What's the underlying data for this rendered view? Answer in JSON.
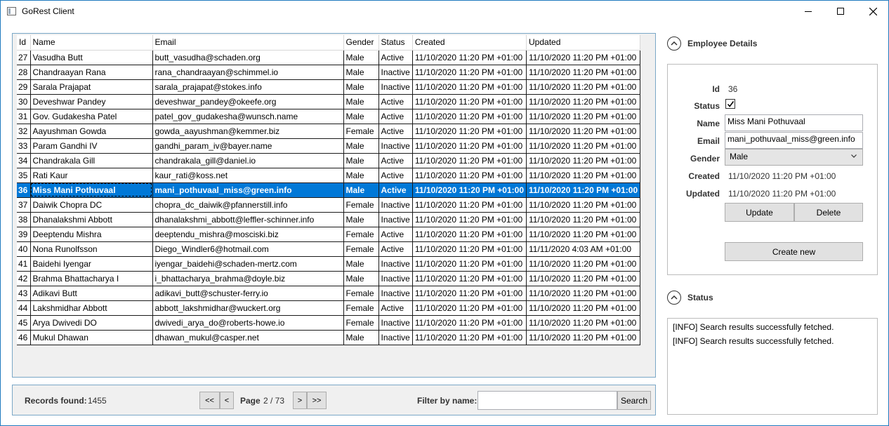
{
  "window": {
    "title": "GoRest Client"
  },
  "table": {
    "columns": [
      "Id",
      "Name",
      "Email",
      "Gender",
      "Status",
      "Created",
      "Updated"
    ],
    "selected_id": "36",
    "rows": [
      {
        "id": "27",
        "name": "Vasudha Butt",
        "email": "butt_vasudha@schaden.org",
        "gender": "Male",
        "status": "Active",
        "created": "11/10/2020 11:20 PM +01:00",
        "updated": "11/10/2020 11:20 PM +01:00"
      },
      {
        "id": "28",
        "name": "Chandraayan Rana",
        "email": "rana_chandraayan@schimmel.io",
        "gender": "Male",
        "status": "Inactive",
        "created": "11/10/2020 11:20 PM +01:00",
        "updated": "11/10/2020 11:20 PM +01:00"
      },
      {
        "id": "29",
        "name": "Sarala Prajapat",
        "email": "sarala_prajapat@stokes.info",
        "gender": "Male",
        "status": "Inactive",
        "created": "11/10/2020 11:20 PM +01:00",
        "updated": "11/10/2020 11:20 PM +01:00"
      },
      {
        "id": "30",
        "name": "Deveshwar Pandey",
        "email": "deveshwar_pandey@okeefe.org",
        "gender": "Male",
        "status": "Active",
        "created": "11/10/2020 11:20 PM +01:00",
        "updated": "11/10/2020 11:20 PM +01:00"
      },
      {
        "id": "31",
        "name": "Gov. Gudakesha Patel",
        "email": "patel_gov_gudakesha@wunsch.name",
        "gender": "Male",
        "status": "Active",
        "created": "11/10/2020 11:20 PM +01:00",
        "updated": "11/10/2020 11:20 PM +01:00"
      },
      {
        "id": "32",
        "name": "Aayushman Gowda",
        "email": "gowda_aayushman@kemmer.biz",
        "gender": "Female",
        "status": "Active",
        "created": "11/10/2020 11:20 PM +01:00",
        "updated": "11/10/2020 11:20 PM +01:00"
      },
      {
        "id": "33",
        "name": "Param Gandhi IV",
        "email": "gandhi_param_iv@bayer.name",
        "gender": "Male",
        "status": "Inactive",
        "created": "11/10/2020 11:20 PM +01:00",
        "updated": "11/10/2020 11:20 PM +01:00"
      },
      {
        "id": "34",
        "name": "Chandrakala Gill",
        "email": "chandrakala_gill@daniel.io",
        "gender": "Male",
        "status": "Active",
        "created": "11/10/2020 11:20 PM +01:00",
        "updated": "11/10/2020 11:20 PM +01:00"
      },
      {
        "id": "35",
        "name": "Rati Kaur",
        "email": "kaur_rati@koss.net",
        "gender": "Male",
        "status": "Active",
        "created": "11/10/2020 11:20 PM +01:00",
        "updated": "11/10/2020 11:20 PM +01:00"
      },
      {
        "id": "36",
        "name": "Miss Mani Pothuvaal",
        "email": "mani_pothuvaal_miss@green.info",
        "gender": "Male",
        "status": "Active",
        "created": "11/10/2020 11:20 PM +01:00",
        "updated": "11/10/2020 11:20 PM +01:00"
      },
      {
        "id": "37",
        "name": "Daiwik Chopra DC",
        "email": "chopra_dc_daiwik@pfannerstill.info",
        "gender": "Female",
        "status": "Inactive",
        "created": "11/10/2020 11:20 PM +01:00",
        "updated": "11/10/2020 11:20 PM +01:00"
      },
      {
        "id": "38",
        "name": "Dhanalakshmi Abbott",
        "email": "dhanalakshmi_abbott@leffler-schinner.info",
        "gender": "Male",
        "status": "Inactive",
        "created": "11/10/2020 11:20 PM +01:00",
        "updated": "11/10/2020 11:20 PM +01:00"
      },
      {
        "id": "39",
        "name": "Deeptendu Mishra",
        "email": "deeptendu_mishra@mosciski.biz",
        "gender": "Female",
        "status": "Active",
        "created": "11/10/2020 11:20 PM +01:00",
        "updated": "11/10/2020 11:20 PM +01:00"
      },
      {
        "id": "40",
        "name": "Nona Runolfsson",
        "email": "Diego_Windler6@hotmail.com",
        "gender": "Female",
        "status": "Active",
        "created": "11/10/2020 11:20 PM +01:00",
        "updated": "11/11/2020 4:03 AM +01:00"
      },
      {
        "id": "41",
        "name": "Baidehi Iyengar",
        "email": "iyengar_baidehi@schaden-mertz.com",
        "gender": "Male",
        "status": "Inactive",
        "created": "11/10/2020 11:20 PM +01:00",
        "updated": "11/10/2020 11:20 PM +01:00"
      },
      {
        "id": "42",
        "name": "Brahma Bhattacharya I",
        "email": "i_bhattacharya_brahma@doyle.biz",
        "gender": "Male",
        "status": "Inactive",
        "created": "11/10/2020 11:20 PM +01:00",
        "updated": "11/10/2020 11:20 PM +01:00"
      },
      {
        "id": "43",
        "name": "Adikavi Butt",
        "email": "adikavi_butt@schuster-ferry.io",
        "gender": "Female",
        "status": "Inactive",
        "created": "11/10/2020 11:20 PM +01:00",
        "updated": "11/10/2020 11:20 PM +01:00"
      },
      {
        "id": "44",
        "name": "Lakshmidhar Abbott",
        "email": "abbott_lakshmidhar@wuckert.org",
        "gender": "Female",
        "status": "Active",
        "created": "11/10/2020 11:20 PM +01:00",
        "updated": "11/10/2020 11:20 PM +01:00"
      },
      {
        "id": "45",
        "name": "Arya Dwivedi DO",
        "email": "dwivedi_arya_do@roberts-howe.io",
        "gender": "Female",
        "status": "Inactive",
        "created": "11/10/2020 11:20 PM +01:00",
        "updated": "11/10/2020 11:20 PM +01:00"
      },
      {
        "id": "46",
        "name": "Mukul Dhawan",
        "email": "dhawan_mukul@casper.net",
        "gender": "Male",
        "status": "Inactive",
        "created": "11/10/2020 11:20 PM +01:00",
        "updated": "11/10/2020 11:20 PM +01:00"
      }
    ]
  },
  "footer": {
    "records_label": "Records found:",
    "records_value": "1455",
    "first_label": "<<",
    "prev_label": "<",
    "page_label": "Page",
    "page_value": "2 / 73",
    "next_label": ">",
    "last_label": ">>",
    "filter_label": "Filter by name:",
    "filter_value": "",
    "search_label": "Search"
  },
  "details": {
    "section_title": "Employee Details",
    "id_label": "Id",
    "id_value": "36",
    "status_label": "Status",
    "status_checked": true,
    "name_label": "Name",
    "name_value": "Miss Mani Pothuvaal",
    "email_label": "Email",
    "email_value": "mani_pothuvaal_miss@green.info",
    "gender_label": "Gender",
    "gender_value": "Male",
    "created_label": "Created",
    "created_value": "11/10/2020 11:20 PM +01:00",
    "updated_label": "Updated",
    "updated_value": "11/10/2020 11:20 PM +01:00",
    "update_button": "Update",
    "delete_button": "Delete",
    "create_button": "Create new"
  },
  "status": {
    "section_title": "Status",
    "lines": [
      "[INFO] Search results successfully fetched.",
      "[INFO] Search results successfully fetched."
    ]
  },
  "colors": {
    "selection": "#0078d7",
    "panel_border": "#7aa7c7",
    "button_face": "#e1e1e1"
  }
}
